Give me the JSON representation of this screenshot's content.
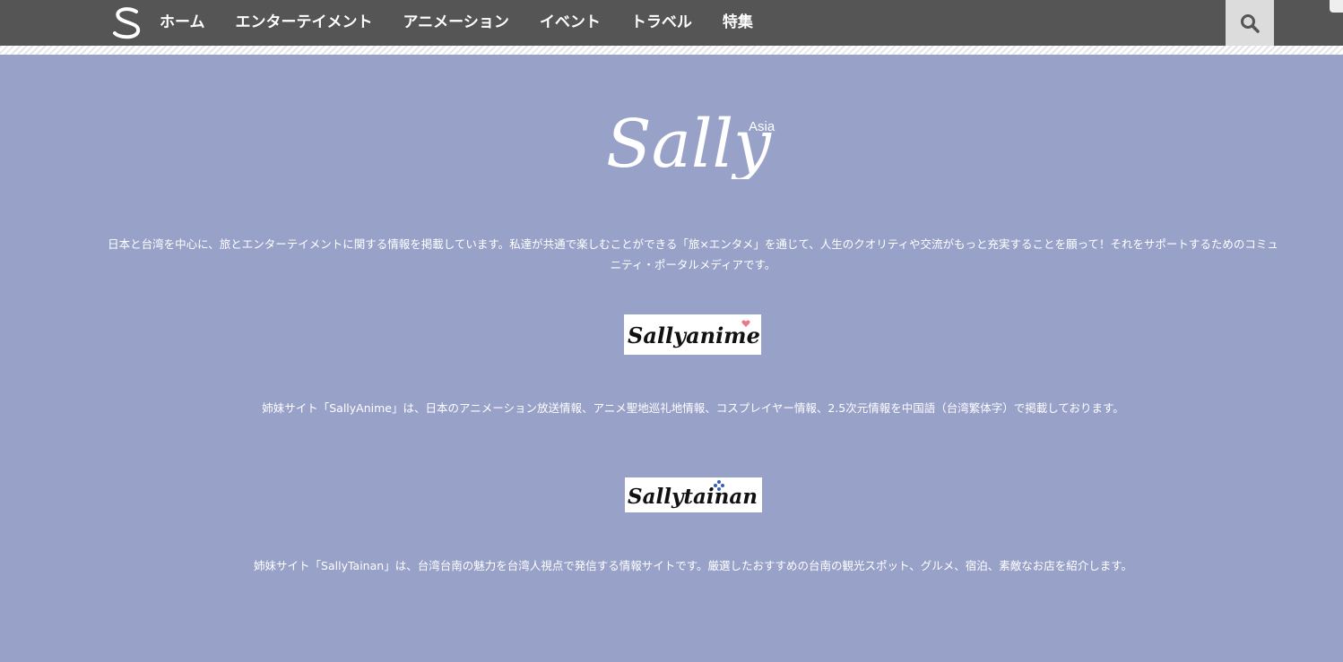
{
  "nav": {
    "items": [
      {
        "label": "ホーム"
      },
      {
        "label": "エンターテイメント"
      },
      {
        "label": "アニメーション"
      },
      {
        "label": "イベント"
      },
      {
        "label": "トラベル"
      },
      {
        "label": "特集"
      }
    ],
    "logo_icon": "sally-s-logo",
    "search_icon": "search-icon"
  },
  "brand": {
    "logo_text": "Sally",
    "logo_suffix": "Asia"
  },
  "intro": {
    "text": "日本と台湾を中心に、旅とエンターテイメントに関する情報を掲載しています。私達が共通で楽しむことができる「旅×エンタメ」を通じて、人生のクオリティや交流がもっと充実することを願って！それをサポートするためのコミュニティ・ポータルメディアです。"
  },
  "sister_sites": {
    "anime": {
      "banner_text": "Sallyanime",
      "description": "姉妹サイト「SallyAnime」は、日本のアニメーション放送情報、アニメ聖地巡礼地情報、コスプレイヤー情報、2.5次元情報を中国語（台湾繁体字）で掲載しております。"
    },
    "tainan": {
      "banner_text": "Sallytainan",
      "description": "姉妹サイト「SallyTainan」は、台湾台南の魅力を台湾人視点で発信する情報サイトです。厳選したおすすめの台南の観光スポット、グルメ、宿泊、素敵なお店を紹介します。"
    }
  },
  "colors": {
    "header_bg": "#555555",
    "page_bg": "#98a1c8",
    "search_bg": "#dcdcdc",
    "text": "#ffffff"
  }
}
